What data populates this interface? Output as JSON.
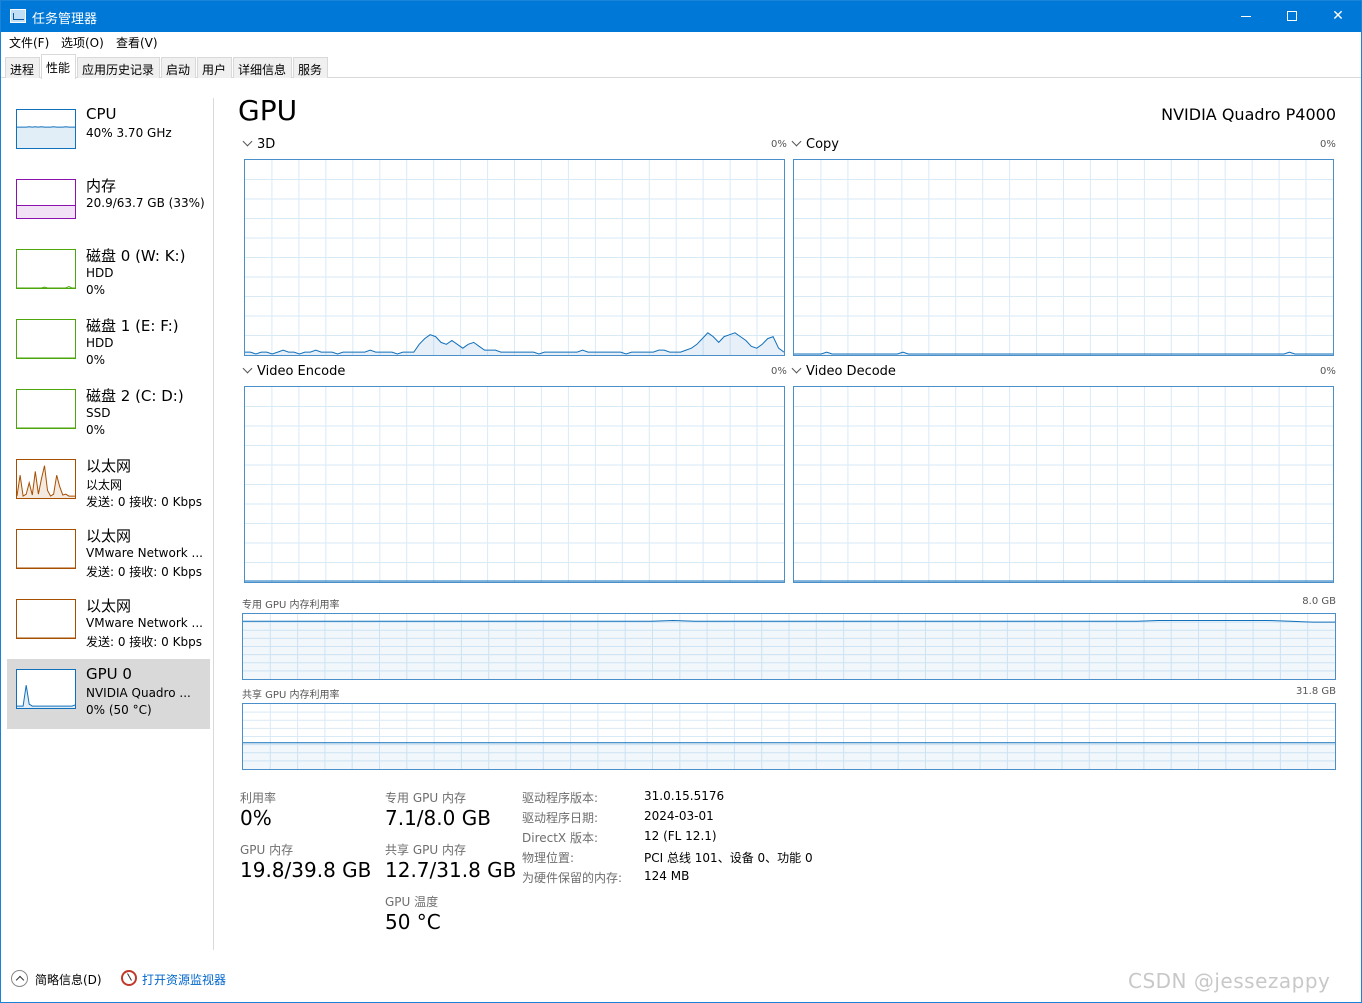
{
  "window": {
    "title": "任务管理器"
  },
  "menu": [
    "文件(F)",
    "选项(O)",
    "查看(V)"
  ],
  "tabs": [
    "进程",
    "性能",
    "应用历史记录",
    "启动",
    "用户",
    "详细信息",
    "服务"
  ],
  "active_tab": "性能",
  "sidebar": [
    {
      "title": "CPU",
      "line1": "40%  3.70 GHz",
      "line2": "",
      "color": "#1170ba",
      "icon": "cpu-graph-icon"
    },
    {
      "title": "内存",
      "line1": "20.9/63.7 GB (33%)",
      "line2": "",
      "color": "#8b12ae",
      "icon": "memory-graph-icon"
    },
    {
      "title": "磁盘 0 (W: K:)",
      "line1": "HDD",
      "line2": "0%",
      "color": "#4da60c",
      "icon": "disk-graph-icon"
    },
    {
      "title": "磁盘 1 (E: F:)",
      "line1": "HDD",
      "line2": "0%",
      "color": "#4da60c",
      "icon": "disk-graph-icon"
    },
    {
      "title": "磁盘 2 (C: D:)",
      "line1": "SSD",
      "line2": "0%",
      "color": "#4da60c",
      "icon": "disk-graph-icon"
    },
    {
      "title": "以太网",
      "line1": "以太网",
      "line2": "发送: 0  接收: 0 Kbps",
      "color": "#a74f01",
      "icon": "ethernet-graph-icon"
    },
    {
      "title": "以太网",
      "line1": "VMware Network ...",
      "line2": "发送: 0  接收: 0 Kbps",
      "color": "#a74f01",
      "icon": "ethernet-graph-icon"
    },
    {
      "title": "以太网",
      "line1": "VMware Network ...",
      "line2": "发送: 0  接收: 0 Kbps",
      "color": "#a74f01",
      "icon": "ethernet-graph-icon"
    },
    {
      "title": "GPU 0",
      "line1": "NVIDIA Quadro ...",
      "line2": "0% (50 °C)",
      "color": "#1170ba",
      "icon": "gpu-graph-icon"
    }
  ],
  "selected_index": 8,
  "main": {
    "title": "GPU",
    "model": "NVIDIA Quadro P4000",
    "engines": [
      {
        "name": "3D",
        "pct": "0%"
      },
      {
        "name": "Copy",
        "pct": "0%"
      },
      {
        "name": "Video Encode",
        "pct": "0%"
      },
      {
        "name": "Video Decode",
        "pct": "0%"
      }
    ],
    "dedicated_label": "专用 GPU 内存利用率",
    "dedicated_max": "8.0 GB",
    "shared_label": "共享 GPU 内存利用率",
    "shared_max": "31.8 GB"
  },
  "stats": {
    "utilization_label": "利用率",
    "utilization": "0%",
    "gpu_mem_label": "GPU 内存",
    "gpu_mem": "19.8/39.8 GB",
    "dedicated_label": "专用 GPU 内存",
    "dedicated": "7.1/8.0 GB",
    "shared_label": "共享 GPU 内存",
    "shared": "12.7/31.8 GB",
    "temp_label": "GPU 温度",
    "temp": "50 °C"
  },
  "info": [
    {
      "key": "驱动程序版本:",
      "value": "31.0.15.5176"
    },
    {
      "key": "驱动程序日期:",
      "value": "2024-03-01"
    },
    {
      "key": "DirectX 版本:",
      "value": "12 (FL 12.1)"
    },
    {
      "key": "物理位置:",
      "value": "PCI 总线 101、设备 0、功能 0"
    },
    {
      "key": "为硬件保留的内存:",
      "value": "124 MB"
    }
  ],
  "footer": {
    "fewer_details": "简略信息(D)",
    "open_monitor": "打开资源监视器"
  },
  "watermark": "CSDN @jessezappy",
  "colors": {
    "titlebar": "#0078d7",
    "graph_border": "#4a8fc9",
    "grid": "#d9eaf7",
    "gpu_line": "#1170ba"
  },
  "chart_data": [
    {
      "type": "area",
      "name": "3D",
      "ylim": [
        0,
        100
      ],
      "values": [
        1,
        1,
        0,
        1,
        1,
        0,
        1,
        2,
        1,
        1,
        0,
        1,
        1,
        2,
        1,
        1,
        1,
        0,
        1,
        1,
        1,
        1,
        1,
        2,
        1,
        1,
        1,
        1,
        0,
        1,
        1,
        1,
        5,
        8,
        10,
        9,
        6,
        5,
        7,
        5,
        3,
        5,
        6,
        4,
        2,
        2,
        2,
        1,
        1,
        1,
        1,
        1,
        1,
        1,
        0,
        1,
        1,
        1,
        1,
        1,
        1,
        1,
        2,
        1,
        1,
        1,
        1,
        1,
        1,
        1,
        0,
        1,
        1,
        1,
        1,
        1,
        2,
        2,
        1,
        1,
        1,
        2,
        3,
        5,
        8,
        11,
        9,
        6,
        9,
        10,
        11,
        9,
        7,
        4,
        3,
        5,
        8,
        9,
        3,
        1
      ]
    },
    {
      "type": "area",
      "name": "Copy",
      "ylim": [
        0,
        100
      ],
      "values": [
        0,
        0,
        0,
        0,
        0,
        0,
        1,
        0,
        0,
        0,
        0,
        0,
        0,
        0,
        0,
        0,
        0,
        0,
        0,
        0,
        1,
        0,
        0,
        0,
        0,
        0,
        0,
        0,
        0,
        0,
        0,
        0,
        0,
        0,
        0,
        0,
        0,
        0,
        0,
        0,
        0,
        0,
        0,
        0,
        0,
        0,
        0,
        0,
        0,
        0,
        0,
        0,
        0,
        0,
        0,
        0,
        0,
        0,
        0,
        0,
        0,
        0,
        0,
        0,
        0,
        0,
        0,
        0,
        0,
        0,
        0,
        0,
        0,
        0,
        0,
        0,
        0,
        0,
        0,
        0,
        0,
        0,
        0,
        0,
        0,
        0,
        0,
        0,
        0,
        0,
        0,
        1,
        0,
        0,
        0,
        0,
        0,
        0,
        0,
        0
      ]
    },
    {
      "type": "area",
      "name": "Video Encode",
      "ylim": [
        0,
        100
      ],
      "values": [
        0,
        0,
        0,
        0,
        0,
        0,
        0,
        0,
        0,
        0
      ]
    },
    {
      "type": "area",
      "name": "Video Decode",
      "ylim": [
        0,
        100
      ],
      "values": [
        0,
        0,
        0,
        0,
        0,
        0,
        0,
        0,
        0,
        0
      ]
    },
    {
      "type": "area",
      "name": "专用 GPU 内存利用率",
      "ylim": [
        0,
        8.0
      ],
      "values": [
        7.2,
        7.2,
        7.2,
        7.2,
        7.2,
        7.2,
        7.2,
        7.2,
        7.2,
        7.2,
        7.2,
        7.2,
        7.2,
        7.2,
        7.2,
        7.2,
        7.2,
        7.2,
        7.2,
        7.2,
        7.2,
        7.2,
        7.2,
        7.2,
        7.2,
        7.2,
        7.2,
        7.2,
        7.2,
        7.2,
        7.2,
        7.2,
        7.2,
        7.2,
        7.2,
        7.2,
        7.2,
        7.2,
        7.25,
        7.3,
        7.25,
        7.2,
        7.2,
        7.2,
        7.2,
        7.2,
        7.2,
        7.2,
        7.2,
        7.2,
        7.2,
        7.2,
        7.2,
        7.2,
        7.2,
        7.2,
        7.2,
        7.2,
        7.2,
        7.2,
        7.2,
        7.2,
        7.2,
        7.2,
        7.2,
        7.2,
        7.2,
        7.2,
        7.2,
        7.2,
        7.2,
        7.2,
        7.2,
        7.2,
        7.2,
        7.2,
        7.2,
        7.2,
        7.2,
        7.2,
        7.2,
        7.2,
        7.25,
        7.3,
        7.3,
        7.3,
        7.3,
        7.3,
        7.3,
        7.3,
        7.3,
        7.3,
        7.3,
        7.3,
        7.25,
        7.2,
        7.15,
        7.1,
        7.1,
        7.1
      ]
    },
    {
      "type": "area",
      "name": "共享 GPU 内存利用率",
      "ylim": [
        0,
        31.8
      ],
      "values": [
        12.7,
        12.7,
        12.7,
        12.7,
        12.7,
        12.7,
        12.7,
        12.7,
        12.7,
        12.7,
        12.7,
        12.7,
        12.7,
        12.7,
        12.7,
        12.7,
        12.7,
        12.7,
        12.7,
        12.7
      ]
    }
  ],
  "sidebar_graphs": [
    [
      55,
      55,
      55,
      55,
      56,
      55,
      56,
      55,
      56,
      55,
      55,
      55,
      56,
      55,
      55,
      55,
      56,
      55,
      55,
      55
    ],
    [
      33,
      33,
      33,
      33,
      33,
      33,
      33,
      33,
      33,
      33,
      33,
      33,
      33,
      33,
      33,
      33,
      33,
      33,
      33,
      33
    ],
    [
      0,
      0,
      0,
      0,
      0,
      0,
      0,
      0,
      0,
      2,
      0,
      0,
      0,
      0,
      0,
      0,
      0,
      4,
      0,
      0
    ],
    [
      0,
      0,
      0,
      0,
      0,
      0,
      0,
      0,
      0,
      0,
      0,
      0,
      0,
      0,
      0,
      0,
      0,
      0,
      0,
      0
    ],
    [
      0,
      0,
      0,
      0,
      0,
      0,
      0,
      0,
      0,
      0,
      0,
      0,
      0,
      0,
      0,
      0,
      0,
      0,
      0,
      0
    ],
    [
      5,
      60,
      5,
      10,
      40,
      8,
      70,
      10,
      50,
      85,
      20,
      5,
      10,
      60,
      30,
      8,
      10,
      5,
      5,
      5
    ],
    [
      0,
      0,
      0,
      0,
      0,
      0,
      0,
      0,
      0,
      0,
      0,
      0,
      0,
      0,
      0,
      0,
      0,
      0,
      0,
      0
    ],
    [
      0,
      0,
      0,
      0,
      0,
      0,
      0,
      0,
      0,
      0,
      0,
      0,
      0,
      0,
      0,
      0,
      0,
      0,
      0,
      0
    ],
    [
      5,
      5,
      5,
      60,
      10,
      5,
      5,
      5,
      5,
      5,
      5,
      5,
      5,
      5,
      5,
      5,
      5,
      5,
      5,
      8
    ]
  ]
}
